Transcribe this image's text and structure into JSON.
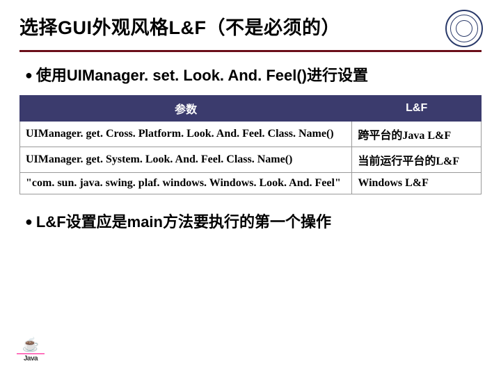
{
  "title": "选择GUI外观风格L&F（不是必须的）",
  "bullet1": "使用UIManager. set. Look. And. Feel()进行设置",
  "table": {
    "headers": {
      "c1": "参数",
      "c2": "L&F"
    },
    "rows": [
      {
        "param": "UIManager. get. Cross. Platform. Look. And. Feel. Class. Name()",
        "lf": "跨平台的Java L&F"
      },
      {
        "param": "UIManager. get. System. Look. And. Feel. Class. Name()",
        "lf": "当前运行平台的L&F"
      },
      {
        "param": "\"com. sun. java. swing. plaf. windows. Windows. Look. And. Feel\"",
        "lf": "Windows L&F"
      }
    ]
  },
  "bullet2": "L&F设置应是main方法要执行的第一个操作",
  "logo": {
    "text": "Java"
  }
}
